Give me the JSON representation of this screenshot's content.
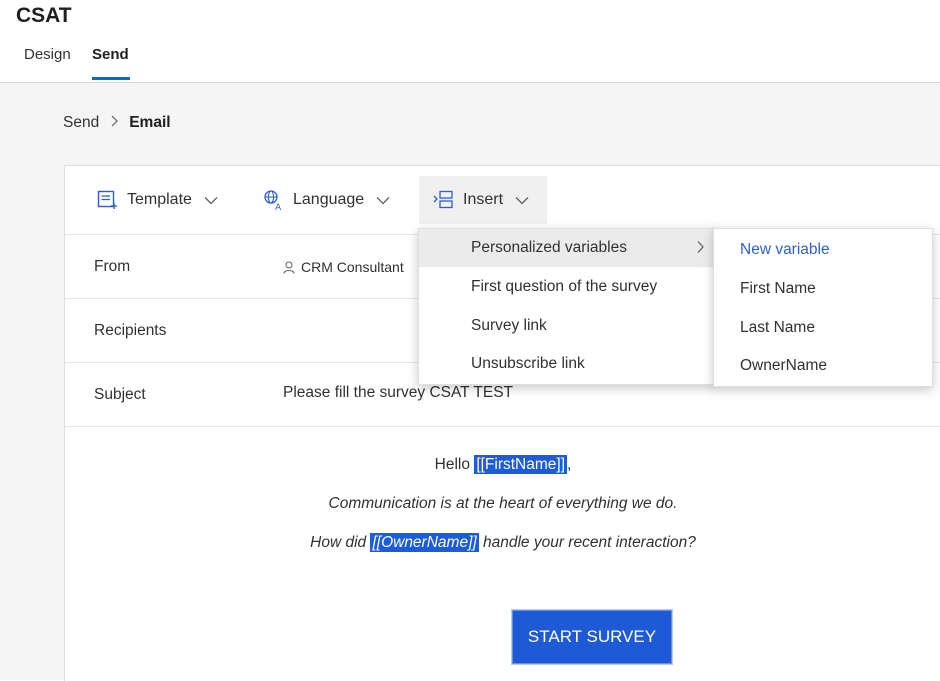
{
  "app": {
    "title": "CSAT"
  },
  "tabs": [
    {
      "label": "Design"
    },
    {
      "label": "Send",
      "selected": true
    }
  ],
  "breadcrumb": {
    "parent": "Send",
    "current": "Email"
  },
  "toolbar": {
    "template_label": "Template",
    "language_label": "Language",
    "insert_label": "Insert"
  },
  "fields": {
    "from": {
      "label": "From",
      "value": "CRM Consultant"
    },
    "recipients": {
      "label": "Recipients",
      "value": ""
    },
    "subject": {
      "label": "Subject",
      "value": "Please fill the survey CSAT TEST"
    }
  },
  "body": {
    "hello_prefix": "Hello",
    "firstname_token": "[[FirstName]]",
    "hello_suffix": ",",
    "communication": "Communication is at the heart of everything we do.",
    "how_prefix": "How did",
    "owner_token": "[[OwnerName]]",
    "how_suffix": "handle your recent interaction?",
    "start_button": "START SURVEY"
  },
  "insert_menu": {
    "items": [
      {
        "label": "Personalized variables",
        "has_submenu": true
      },
      {
        "label": "First question of the survey"
      },
      {
        "label": "Survey link"
      },
      {
        "label": "Unsubscribe link"
      }
    ]
  },
  "variables_menu": {
    "items": [
      {
        "label": "New variable"
      },
      {
        "label": "First Name"
      },
      {
        "label": "Last Name"
      },
      {
        "label": "OwnerName"
      }
    ]
  },
  "colors": {
    "accent": "#0f6cbd",
    "token_highlight": "#1c5bd9",
    "button": "#1f5ad6",
    "link": "#2f5fd0"
  }
}
